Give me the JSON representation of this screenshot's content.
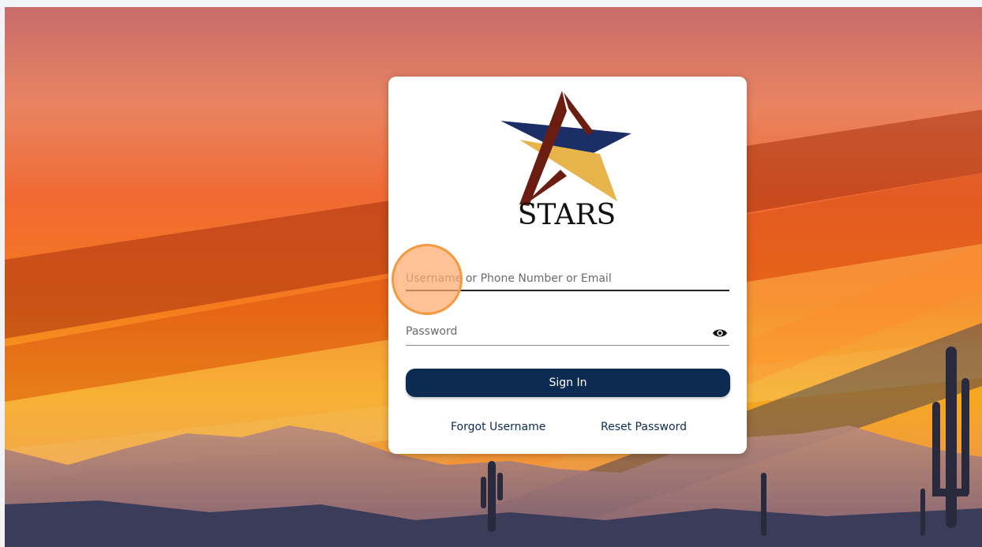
{
  "login": {
    "logo_text": "STARS",
    "username_placeholder": "Username or Phone Number or Email",
    "password_placeholder": "Password",
    "signin_label": "Sign In",
    "forgot_username": "Forgot Username",
    "reset_password": "Reset Password"
  },
  "icons": {
    "password_toggle": "eye-icon"
  },
  "colors": {
    "primary": "#0d2b52",
    "logo_navy": "#1b2f66",
    "logo_gold": "#e7b44c",
    "logo_maroon": "#6b1d12",
    "click_highlight": "#f39a3f"
  }
}
